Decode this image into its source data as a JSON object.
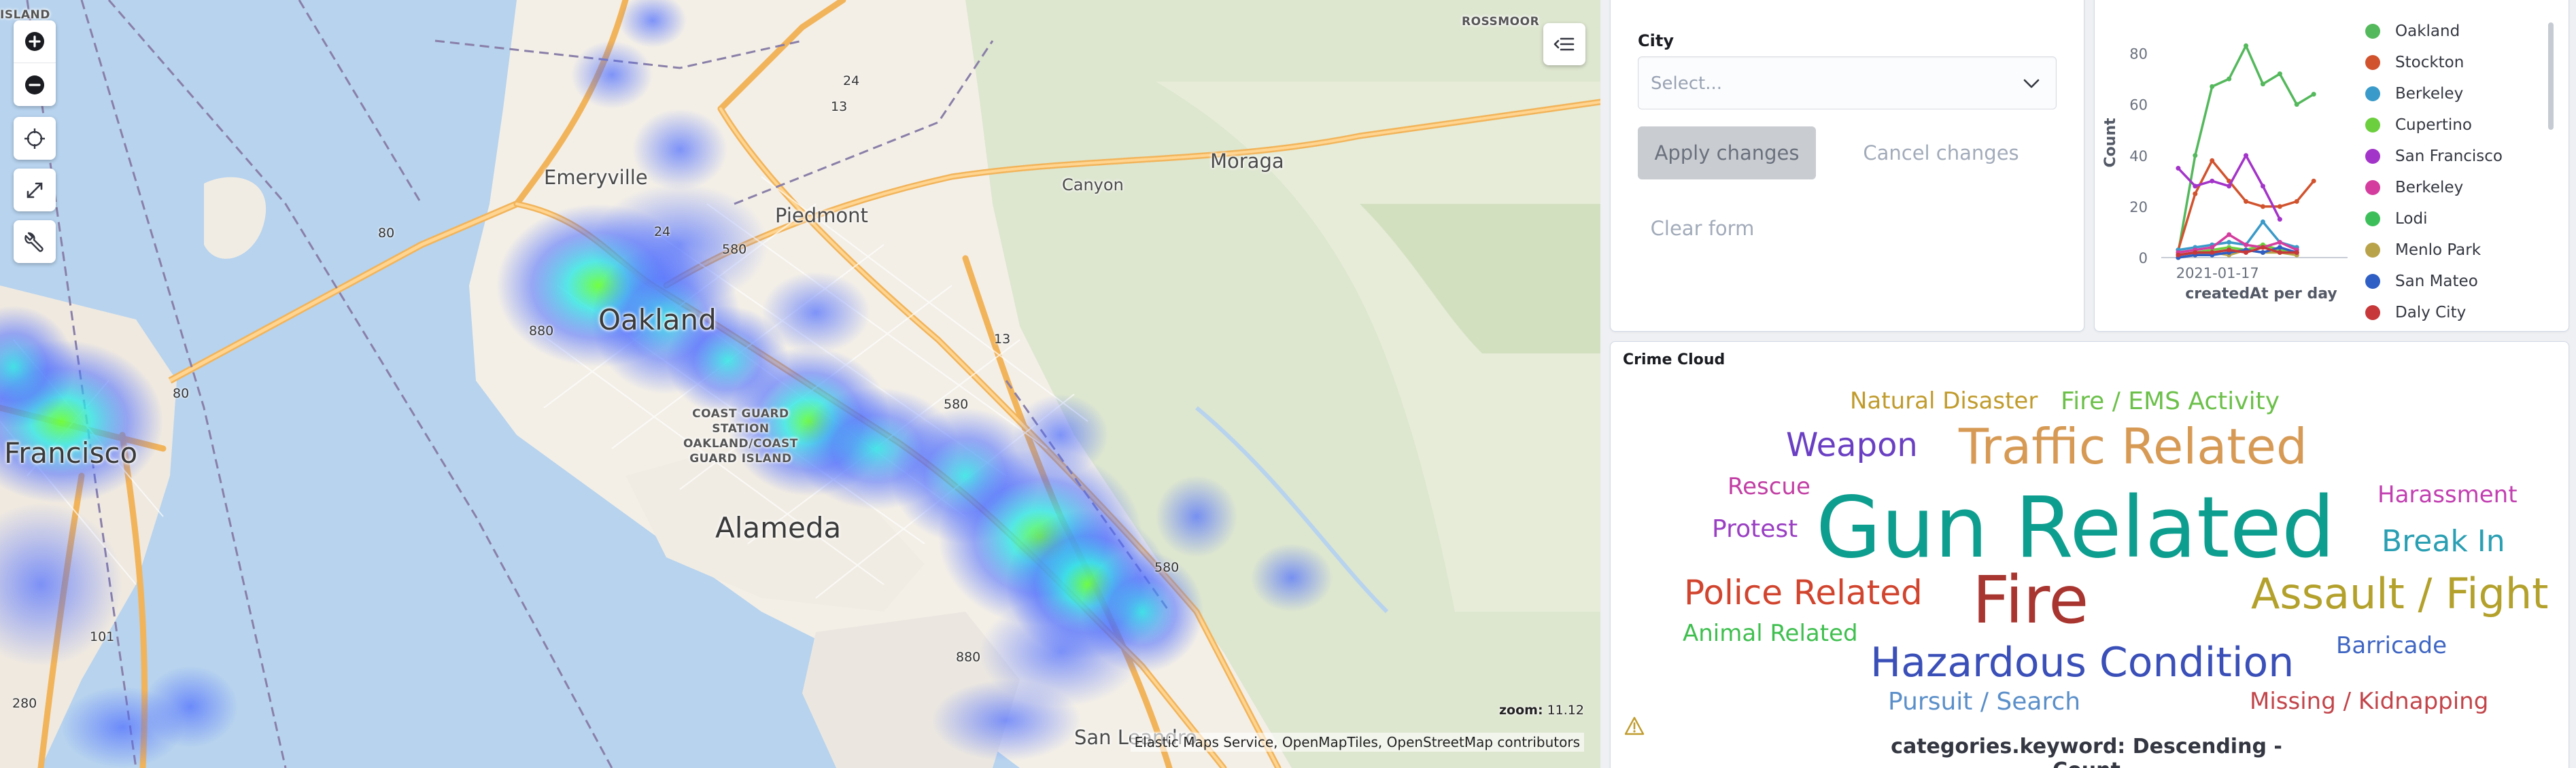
{
  "map": {
    "places": [
      {
        "id": "rossmoor",
        "label": "ROSSMOOR"
      },
      {
        "id": "island",
        "label": "ISLAND"
      },
      {
        "id": "emeryville",
        "label": "Emeryville"
      },
      {
        "id": "piedmont",
        "label": "Piedmont"
      },
      {
        "id": "oakland",
        "label": "Oakland"
      },
      {
        "id": "canyon",
        "label": "Canyon"
      },
      {
        "id": "moraga",
        "label": "Moraga"
      },
      {
        "id": "francisco",
        "label": "Francisco"
      },
      {
        "id": "coast-guard",
        "label": "COAST GUARD\nSTATION\nOAKLAND/COAST\nGUARD ISLAND"
      },
      {
        "id": "alameda",
        "label": "Alameda"
      },
      {
        "id": "san-leandro",
        "label": "San Leandro"
      }
    ],
    "route_shields": [
      "24",
      "13",
      "80",
      "24",
      "580",
      "880",
      "80",
      "13",
      "580",
      "580",
      "880",
      "101",
      "280"
    ],
    "zoom_label": "zoom:",
    "zoom_value": "11.12",
    "attribution": "Elastic Maps Service, OpenMapTiles, OpenStreetMap contributors",
    "heat_palette": {
      "low": "#4b6bff",
      "mid": "#2ee6e6",
      "high": "#6dff3a"
    }
  },
  "controls": {
    "city_label": "City",
    "city_placeholder": "Select...",
    "apply_label": "Apply changes",
    "cancel_label": "Cancel changes",
    "clear_label": "Clear form"
  },
  "chart": {
    "legend": [
      {
        "name": "Oakland",
        "color": "#54b85c"
      },
      {
        "name": "Stockton",
        "color": "#d1532e"
      },
      {
        "name": "Berkeley",
        "color": "#3a9ac9"
      },
      {
        "name": "Cupertino",
        "color": "#6ccf3e"
      },
      {
        "name": "San Francisco",
        "color": "#a334c9"
      },
      {
        "name": "Berkeley",
        "color": "#d43d9e"
      },
      {
        "name": "Lodi",
        "color": "#3cbf5a"
      },
      {
        "name": "Menlo Park",
        "color": "#b8a24a"
      },
      {
        "name": "San Mateo",
        "color": "#2f5fc4"
      },
      {
        "name": "Daly City",
        "color": "#c7383a"
      }
    ]
  },
  "chart_data": {
    "type": "line",
    "x": [
      "d1",
      "d2",
      "d3",
      "d4",
      "d5",
      "d6",
      "d7",
      "d8",
      "d9",
      "d10",
      "d11",
      "d12"
    ],
    "ylim": [
      0,
      90
    ],
    "yticks": [
      0,
      20,
      40,
      60,
      80
    ],
    "xtick_label": "2021-01-17",
    "ylabel": "Count",
    "xlabel": "createdAt per day",
    "series": [
      {
        "name": "Oakland",
        "color": "#54b85c",
        "values": [
          2,
          40,
          67,
          70,
          83,
          68,
          72,
          60,
          64
        ]
      },
      {
        "name": "Stockton",
        "color": "#d1532e",
        "values": [
          3,
          25,
          38,
          30,
          22,
          20,
          20,
          22,
          30
        ]
      },
      {
        "name": "San Francisco",
        "color": "#a334c9",
        "values": [
          35,
          28,
          30,
          28,
          40,
          28,
          15
        ]
      },
      {
        "name": "Berkeley",
        "color": "#3a9ac9",
        "values": [
          3,
          4,
          5,
          6,
          5,
          14,
          6,
          4
        ]
      },
      {
        "name": "Cupertino",
        "color": "#6ccf3e",
        "values": [
          1,
          2,
          3,
          4,
          3,
          5,
          3,
          2
        ]
      },
      {
        "name": "Berkeley",
        "color": "#d43d9e",
        "values": [
          2,
          3,
          4,
          9,
          5,
          4,
          6,
          3
        ]
      },
      {
        "name": "Menlo Park",
        "color": "#b8a24a",
        "values": [
          0,
          1,
          2,
          1,
          3,
          2,
          2,
          1
        ]
      },
      {
        "name": "San Mateo",
        "color": "#2f5fc4",
        "values": [
          0,
          1,
          1,
          2,
          3,
          2,
          4,
          2
        ]
      },
      {
        "name": "Daly City",
        "color": "#c7383a",
        "values": [
          1,
          2,
          2,
          3,
          2,
          4,
          2,
          2
        ]
      }
    ]
  },
  "cloud": {
    "title": "Crime Cloud",
    "footer": "categories.keyword: Descending - Count",
    "words": [
      {
        "text": "Natural Disaster",
        "color": "#c09b2c"
      },
      {
        "text": "Fire / EMS Activity",
        "color": "#6cc04a"
      },
      {
        "text": "Weapon",
        "color": "#6a3fc3"
      },
      {
        "text": "Traffic Related",
        "color": "#d79a55"
      },
      {
        "text": "Rescue",
        "color": "#c23fa5"
      },
      {
        "text": "Harassment",
        "color": "#c23fb1"
      },
      {
        "text": "Protest",
        "color": "#9a3fc3"
      },
      {
        "text": "Gun Related",
        "color": "#0e9e8f"
      },
      {
        "text": "Break In",
        "color": "#2a9fb3"
      },
      {
        "text": "Police Related",
        "color": "#d1442e"
      },
      {
        "text": "Fire",
        "color": "#a8352f"
      },
      {
        "text": "Assault / Fight",
        "color": "#b3a12c"
      },
      {
        "text": "Animal Related",
        "color": "#3fbf4f"
      },
      {
        "text": "Barricade",
        "color": "#3f66c3"
      },
      {
        "text": "Hazardous Condition",
        "color": "#3a4fb8"
      },
      {
        "text": "Pursuit / Search",
        "color": "#5b8fc9"
      },
      {
        "text": "Missing / Kidnapping",
        "color": "#c2454a"
      }
    ]
  }
}
